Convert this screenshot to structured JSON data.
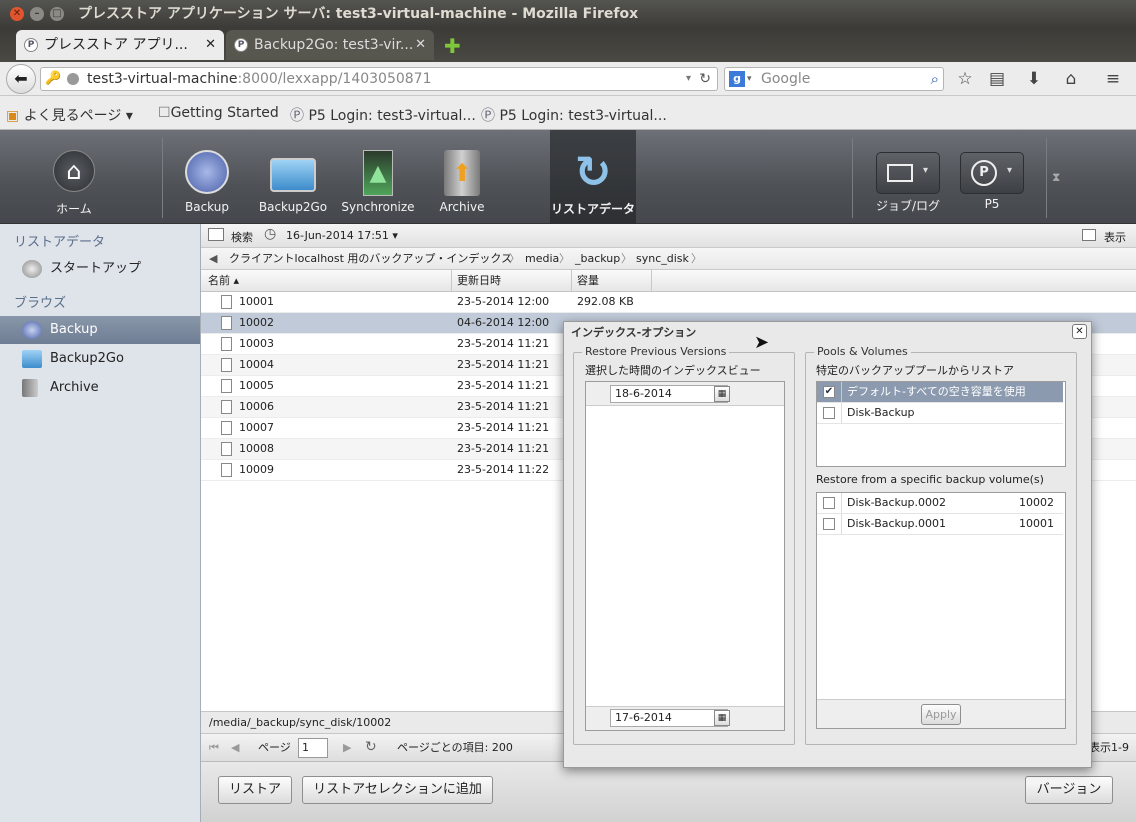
{
  "window": {
    "title": "プレスストア アプリケーション サーバ: test3-virtual-machine - Mozilla Firefox"
  },
  "tabs": [
    {
      "label": "プレスストア アプリ...",
      "active": true
    },
    {
      "label": "Backup2Go: test3-vir...",
      "active": false
    }
  ],
  "nav": {
    "url_host": "test3-virtual-machine",
    "url_rest": ":8000/lexxapp/1403050871",
    "search_placeholder": "Google"
  },
  "bookmarks": [
    {
      "label": "よく見るページ ▾",
      "icon": "folder-icon"
    },
    {
      "label": "Getting Started",
      "icon": "page-icon"
    },
    {
      "label": "P5 Login: test3-virtual...",
      "icon": "p5-icon"
    },
    {
      "label": "P5 Login: test3-virtual...",
      "icon": "p5-icon"
    }
  ],
  "header": {
    "home": "ホーム",
    "backup": "Backup",
    "backup2go": "Backup2Go",
    "synchronize": "Synchronize",
    "archive": "Archive",
    "restore": "リストアデータ",
    "joblog": "ジョブ/ログ",
    "p5": "P5"
  },
  "sidebar": {
    "section1": "リストアデータ",
    "startup": "スタートアップ",
    "section2": "ブラウズ",
    "items": [
      "Backup",
      "Backup2Go",
      "Archive"
    ]
  },
  "toolbar": {
    "search": "検索",
    "date": "16-Jun-2014 17:51 ▾",
    "view": "表示"
  },
  "breadcrumb": [
    "クライアントlocalhost 用のバックアップ・インデックス",
    "media",
    "_backup",
    "sync_disk"
  ],
  "table": {
    "headers": {
      "name": "名前 ▴",
      "modified": "更新日時",
      "size": "容量"
    },
    "rows": [
      {
        "name": "10001",
        "modified": "23-5-2014 12:00",
        "size": "292.08 KB"
      },
      {
        "name": "10002",
        "modified": "04-6-2014 12:00",
        "size": ""
      },
      {
        "name": "10003",
        "modified": "23-5-2014 11:21",
        "size": ""
      },
      {
        "name": "10004",
        "modified": "23-5-2014 11:21",
        "size": ""
      },
      {
        "name": "10005",
        "modified": "23-5-2014 11:21",
        "size": ""
      },
      {
        "name": "10006",
        "modified": "23-5-2014 11:21",
        "size": ""
      },
      {
        "name": "10007",
        "modified": "23-5-2014 11:21",
        "size": ""
      },
      {
        "name": "10008",
        "modified": "23-5-2014 11:21",
        "size": ""
      },
      {
        "name": "10009",
        "modified": "23-5-2014 11:22",
        "size": ""
      }
    ]
  },
  "status_path": "/media/_backup/sync_disk/10002",
  "pager": {
    "page_label": "ページ",
    "page": "1",
    "per_page": "ページごとの項目: 200",
    "display": "表示1-9"
  },
  "buttons": {
    "restore": "リストア",
    "add_selection": "リストアセレクションに追加",
    "version": "バージョン"
  },
  "dialog": {
    "title": "インデックス-オプション",
    "left_legend": "Restore Previous Versions",
    "left_caption": "選択した時間のインデックスビュー",
    "date_from": "18-6-2014",
    "date_to": "17-6-2014",
    "right_legend": "Pools & Volumes",
    "pools_caption": "特定のバックアッププールからリストア",
    "pools": [
      {
        "label": "デフォルト-すべての空き容量を使用",
        "checked": true
      },
      {
        "label": "Disk-Backup",
        "checked": false
      }
    ],
    "volumes_caption": "Restore from a specific backup volume(s)",
    "volumes": [
      {
        "label": "Disk-Backup.0002",
        "id": "10002"
      },
      {
        "label": "Disk-Backup.0001",
        "id": "10001"
      }
    ],
    "apply": "Apply"
  }
}
